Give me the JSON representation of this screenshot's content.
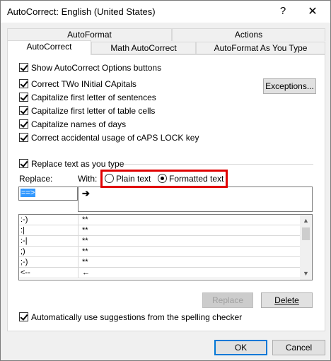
{
  "window": {
    "title": "AutoCorrect: English (United States)",
    "help_glyph": "?",
    "close_glyph": "✕"
  },
  "tabs": {
    "back_row": [
      "AutoFormat",
      "Actions"
    ],
    "front_row": [
      "AutoCorrect",
      "Math AutoCorrect",
      "AutoFormat As You Type"
    ],
    "active": "AutoCorrect"
  },
  "options": {
    "show_buttons": "Show AutoCorrect Options buttons",
    "two_initial_caps": "Correct TWo INitial CApitals",
    "cap_sentences": "Capitalize first letter of sentences",
    "cap_table_cells": "Capitalize first letter of table cells",
    "cap_days": "Capitalize names of days",
    "caps_lock": "Correct accidental usage of cAPS LOCK key",
    "exceptions_button": "Exceptions...",
    "replace_as_you_type": "Replace text as you type"
  },
  "replace": {
    "replace_label": "Replace:",
    "with_label": "With:",
    "plain_text": "Plain text",
    "formatted_text": "Formatted text",
    "selected_format": "Formatted text",
    "replace_value": "==>",
    "with_value": "➔"
  },
  "entries": [
    {
      "replace": ":-)",
      "with": "**"
    },
    {
      "replace": ":|",
      "with": "**"
    },
    {
      "replace": ":-|",
      "with": "**"
    },
    {
      "replace": ";)",
      "with": "**"
    },
    {
      "replace": ";-)",
      "with": "**"
    },
    {
      "replace": "<--",
      "with": "←"
    }
  ],
  "buttons": {
    "replace": "Replace",
    "delete": "Delete",
    "ok": "OK",
    "cancel": "Cancel"
  },
  "spelling_suggestions": "Automatically use suggestions from the spelling checker"
}
